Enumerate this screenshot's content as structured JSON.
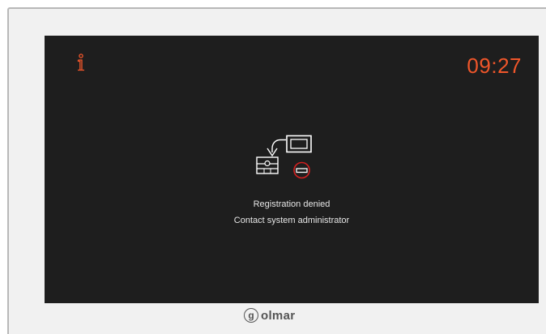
{
  "status": {
    "time": "09:27",
    "line1": "Registration denied",
    "line2": "Contact system administrator"
  },
  "brand": {
    "name": "olmar",
    "mark": "g"
  },
  "icons": {
    "info": "info-icon",
    "monitor": "monitor-icon",
    "door-panel": "door-panel-icon",
    "arrow": "curved-arrow-icon",
    "denied": "no-entry-icon"
  },
  "colors": {
    "accent": "#f0562a",
    "screen": "#1e1e1e",
    "denied": "#d42020",
    "bezel": "#f1f1f1"
  }
}
